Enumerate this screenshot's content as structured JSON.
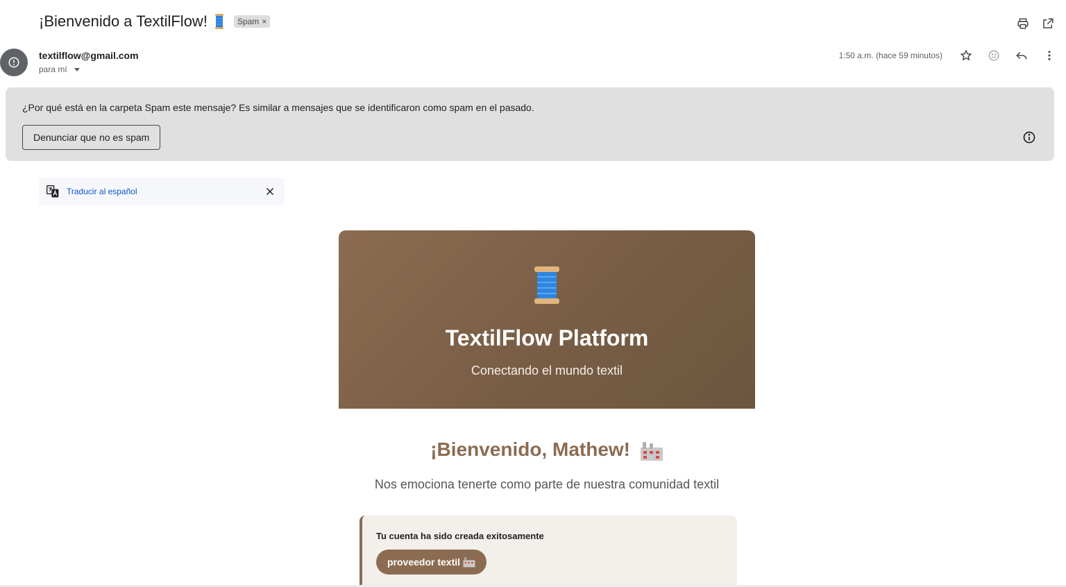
{
  "email": {
    "subject": "¡Bienvenido a TextilFlow!",
    "label_chip": "Spam",
    "sender": "textilflow@gmail.com",
    "recipient": "para mí",
    "timestamp": "1:50 a.m. (hace 59 minutos)"
  },
  "toolbar": {
    "icons": [
      "print-icon",
      "open-in-new-window-icon",
      "star-icon",
      "emoji-reaction-icon",
      "reply-icon",
      "more-vert-icon"
    ]
  },
  "spam_notice": {
    "question": "¿Por qué está en la carpeta Spam este mensaje?",
    "reason": " Es similar a mensajes que se identificaron como spam en el pasado.",
    "report_button": "Denunciar que no es spam"
  },
  "translate": {
    "link": "Traducir al español"
  },
  "message_body": {
    "hero_title": "TextilFlow Platform",
    "hero_subtitle": "Conectando el mundo textil",
    "welcome_heading": "¡Bienvenido, Mathew!",
    "intro": "Nos emociona tenerte como parte de nuestra comunidad textil",
    "card_title": "Tu cuenta ha sido creada exitosamente",
    "role_badge": "proveedor textil"
  },
  "colors": {
    "brand_brown": "#8b6c52",
    "spam_banner_bg": "#e0e0e0",
    "link_blue": "#0b57d0"
  }
}
